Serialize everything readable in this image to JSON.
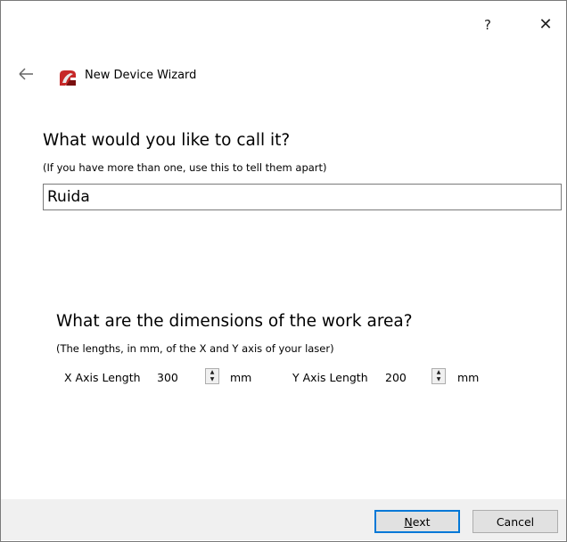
{
  "titlebar": {
    "help_label": "?",
    "close_label": "✕"
  },
  "header": {
    "title": "New Device Wizard",
    "back_icon": "back-arrow-icon",
    "app_icon": "wizard-app-icon"
  },
  "name_section": {
    "heading": "What would you like to call it?",
    "hint": "(If you have more than one, use this to tell them apart)",
    "value": "Ruida"
  },
  "dimensions_section": {
    "heading": "What are the dimensions of the work area?",
    "hint": "(The lengths, in mm, of the X and Y axis of your laser)",
    "x_label": "X Axis Length",
    "x_value": "300",
    "x_unit": "mm",
    "y_label": "Y Axis Length",
    "y_value": "200",
    "y_unit": "mm"
  },
  "footer": {
    "next_mnemonic": "N",
    "next_rest": "ext",
    "cancel_label": "Cancel"
  },
  "colors": {
    "accent": "#0078d7",
    "footer_bg": "#f0f0f0",
    "icon_red": "#c62828"
  }
}
